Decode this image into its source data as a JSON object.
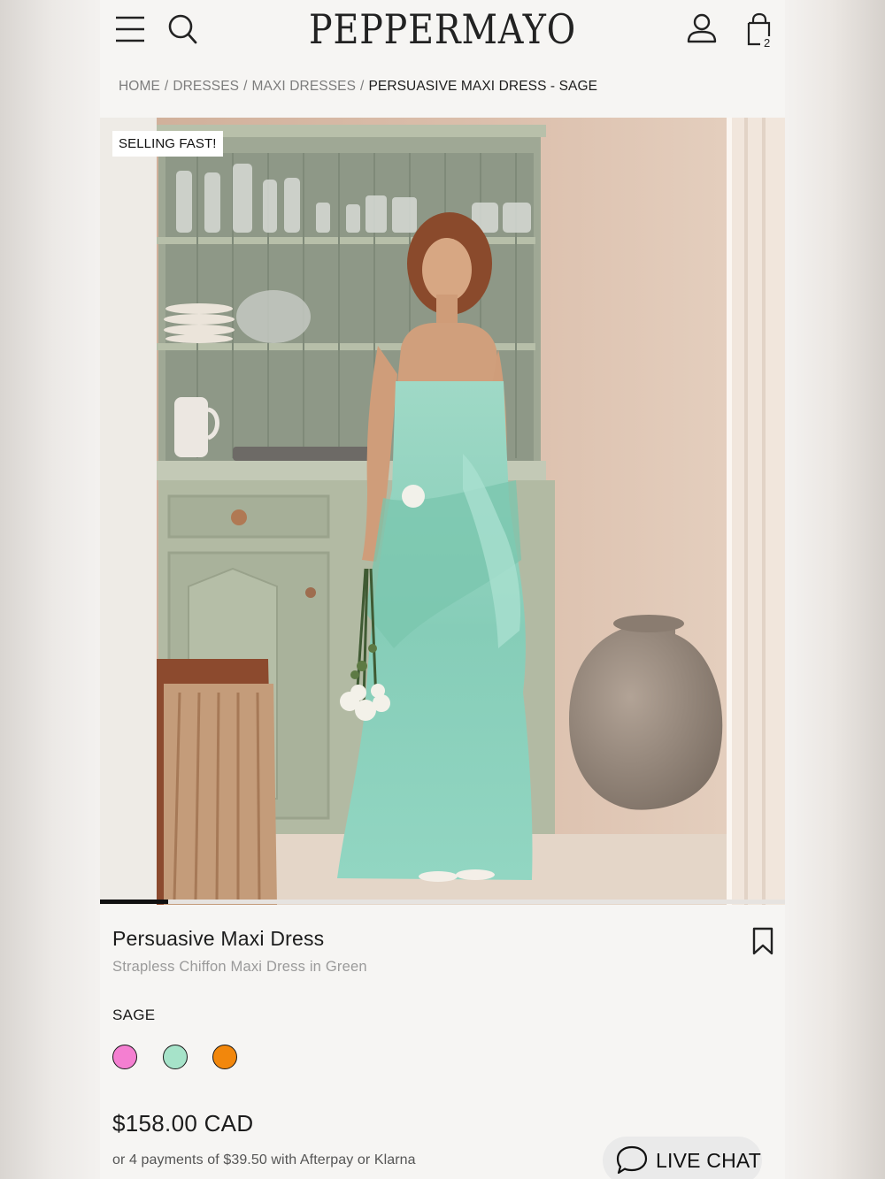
{
  "header": {
    "logo": "PEPPERMAYO",
    "bag_count": "2"
  },
  "breadcrumb": {
    "items": [
      "HOME",
      "DRESSES",
      "MAXI DRESSES"
    ],
    "separator": "/",
    "current": "PERSUASIVE MAXI DRESS - SAGE"
  },
  "gallery": {
    "badge": "SELLING FAST!",
    "progress_fraction": 0.1
  },
  "product": {
    "title": "Persuasive Maxi Dress",
    "subtitle": "Strapless Chiffon Maxi Dress in Green",
    "color_label": "SAGE",
    "swatches": [
      {
        "name": "pink",
        "color": "#f47fd1"
      },
      {
        "name": "sage",
        "color": "#a6e3c9"
      },
      {
        "name": "orange",
        "color": "#f2870c"
      }
    ],
    "price": "$158.00 CAD",
    "installments": "or 4 payments of $39.50 with Afterpay or Klarna"
  },
  "chat": {
    "label": "LIVE CHAT"
  },
  "colors": {
    "background": "#f6f5f3",
    "dress": "#8ed3c0",
    "wall": "#d8b9a3",
    "cabinet": "#b8c0aa"
  }
}
